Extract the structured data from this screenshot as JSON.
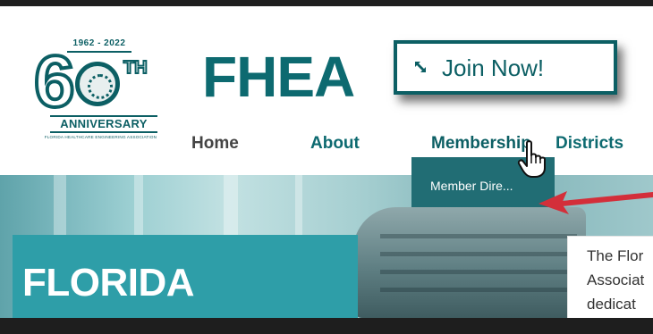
{
  "logo": {
    "years": "1962 - 2022",
    "numeral": "6",
    "ordinal": "TH",
    "anniversary": "ANNIVERSARY",
    "association": "FLORIDA HEALTHCARE ENGINEERING ASSOCIATION"
  },
  "brand": "FHEA",
  "join_button": {
    "label": "Join Now!",
    "icon": "diagonal-arrows-icon"
  },
  "nav": {
    "items": [
      {
        "label": "Home"
      },
      {
        "label": "About"
      },
      {
        "label": "Membership"
      },
      {
        "label": "Districts"
      }
    ]
  },
  "dropdown": {
    "items": [
      {
        "label": "Member Dire..."
      }
    ]
  },
  "hero": {
    "title": "FLORIDA",
    "card_lines": [
      "The Flor",
      "Associat",
      "dedicat"
    ]
  },
  "colors": {
    "brand_teal": "#0d6a70",
    "dark_teal": "#0c5f64",
    "dropdown_bg": "#216d74",
    "hero_teal": "#2e9ea8",
    "arrow_red": "#d32f3a"
  }
}
